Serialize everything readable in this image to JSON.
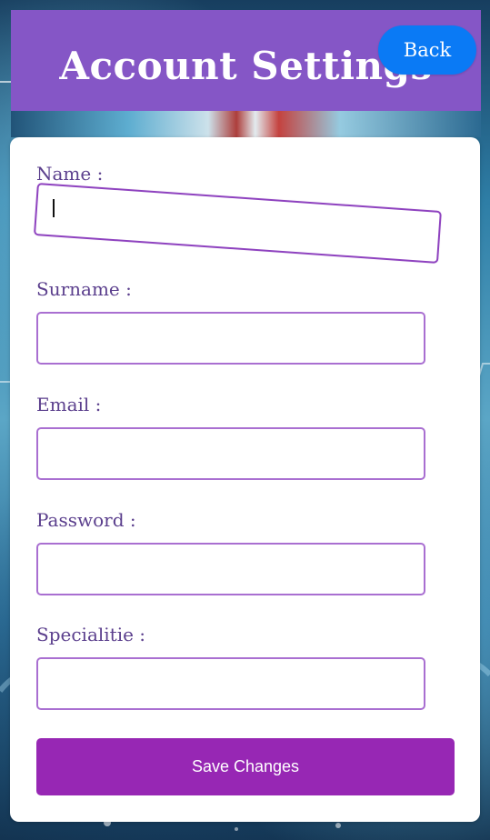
{
  "header": {
    "title": "Account Settings",
    "back_label": "Back"
  },
  "form": {
    "fields": [
      {
        "label": "Name :",
        "value": ""
      },
      {
        "label": "Surname :",
        "value": ""
      },
      {
        "label": "Email :",
        "value": ""
      },
      {
        "label": "Password :",
        "value": ""
      },
      {
        "label": "Specialitie :",
        "value": ""
      }
    ],
    "save_label": "Save Changes"
  },
  "theme": {
    "header_color": "#8556c6",
    "back_button_color": "#0a7af5",
    "field_border_color": "#a96fd1",
    "label_color": "#5b3f8d",
    "save_button_color": "#9727b4",
    "card_background": "#ffffff"
  }
}
